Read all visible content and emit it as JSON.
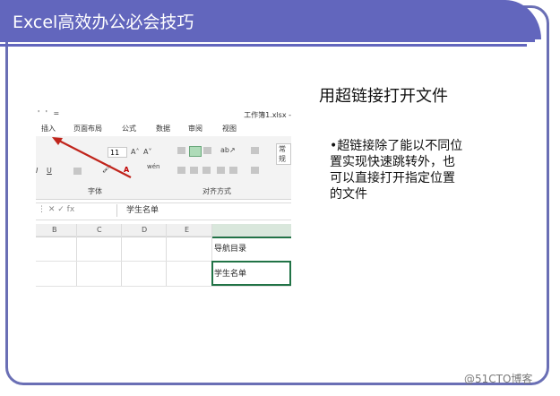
{
  "slide": {
    "title": "Excel高效办公必会技巧",
    "heading": "用超链接打开文件",
    "bullet": "•超链接除了能以不同位置实现快速跳转外，也可以直接打开指定位置的文件",
    "watermark": "@51CTO博客"
  },
  "excel": {
    "quick_access": "' ' =",
    "workbook_title": "工作簿1.xlsx -",
    "tabs": [
      "插入",
      "页面布局",
      "公式",
      "数据",
      "审阅",
      "视图"
    ],
    "font_size": "11",
    "number_format": "常规",
    "group_font": "字体",
    "group_align": "对齐方式",
    "formula_icons": "⋮   ✕   ✓   fx",
    "formula_value": "学生名单",
    "columns": [
      "B",
      "C",
      "D",
      "E"
    ],
    "cells": {
      "nav": "导航目录",
      "students": "学生名单"
    },
    "colors": {
      "arrow": "#c0241b",
      "selection": "#217346",
      "title_band": "#6266bd"
    }
  }
}
